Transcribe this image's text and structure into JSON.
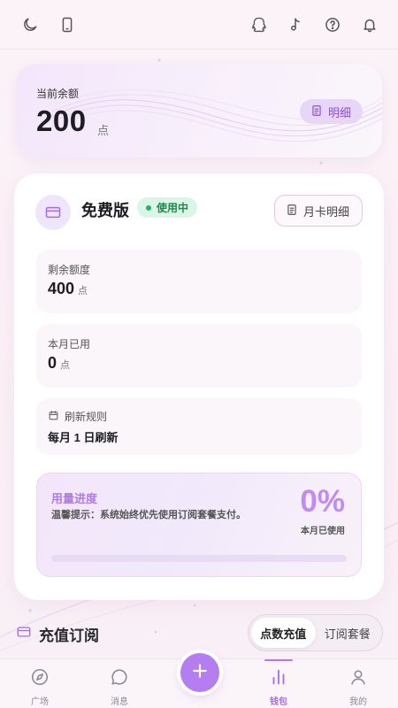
{
  "topbar": {
    "left_icons": [
      "moon-icon",
      "phone-icon"
    ],
    "right_icons": [
      "qq-icon",
      "music-note-icon",
      "help-icon",
      "bell-icon"
    ]
  },
  "balance": {
    "label": "当前余额",
    "value": "200",
    "unit": "点",
    "detail_label": "明细"
  },
  "plan": {
    "name": "免费版",
    "status": "使用中",
    "month_detail_label": "月卡明细",
    "remaining_label": "剩余额度",
    "remaining_value": "400",
    "remaining_unit": "点",
    "used_label": "本月已用",
    "used_value": "0",
    "used_unit": "点",
    "rule_label": "刷新规则",
    "rule_value": "每月 1 日刷新"
  },
  "usage": {
    "title": "用量进度",
    "tip": "温馨提示：系统始终优先使用订阅套餐支付。",
    "percent_text": "0%",
    "percent_value": 0,
    "caption": "本月已使用"
  },
  "recharge": {
    "title": "充值订阅",
    "tabs": [
      {
        "label": "点数充值",
        "active": true
      },
      {
        "label": "订阅套餐",
        "active": false
      }
    ]
  },
  "nav": {
    "items": [
      {
        "label": "广场",
        "icon": "compass-icon",
        "active": false
      },
      {
        "label": "消息",
        "icon": "chat-icon",
        "active": false
      },
      {
        "label": "钱包",
        "icon": "wallet-bars-icon",
        "active": true
      },
      {
        "label": "我的",
        "icon": "user-icon",
        "active": false
      }
    ],
    "fab_icon": "plus-icon"
  },
  "colors": {
    "accent": "#b07ce0",
    "status_green": "#22b36a",
    "balance_pill": "#e8d6f7"
  }
}
